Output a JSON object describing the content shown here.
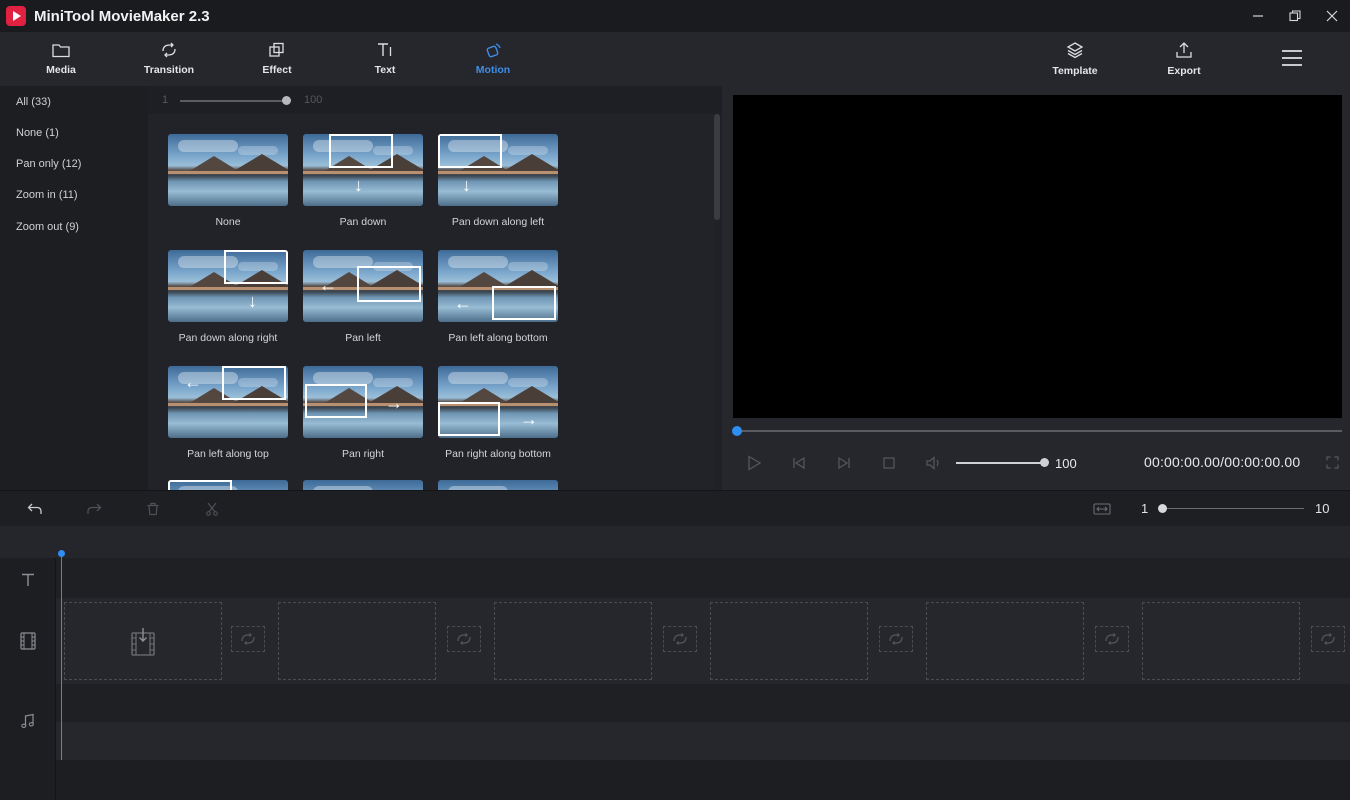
{
  "window": {
    "title": "MiniTool MovieMaker 2.3",
    "controls": [
      "minimize-icon",
      "restore-icon",
      "close-icon"
    ]
  },
  "toolbar": {
    "tabs": [
      {
        "label": "Media",
        "icon": "folder-icon",
        "active": false
      },
      {
        "label": "Transition",
        "icon": "transition-icon",
        "active": false
      },
      {
        "label": "Effect",
        "icon": "effect-icon",
        "active": false
      },
      {
        "label": "Text",
        "icon": "text-icon",
        "active": false
      },
      {
        "label": "Motion",
        "icon": "motion-icon",
        "active": true
      }
    ],
    "right": [
      {
        "label": "Template",
        "icon": "layers-icon"
      },
      {
        "label": "Export",
        "icon": "upload-icon"
      }
    ],
    "menu_icon": "hamburger-menu-icon"
  },
  "categories": [
    {
      "label": "All",
      "count": "(33)"
    },
    {
      "label": "None",
      "count": "(1)"
    },
    {
      "label": "Pan only",
      "count": "(12)"
    },
    {
      "label": "Zoom in",
      "count": "(11)"
    },
    {
      "label": "Zoom out",
      "count": "(9)"
    }
  ],
  "thumb_size": {
    "min": "1",
    "max": "100",
    "value": 100
  },
  "motions": [
    {
      "label": "None"
    },
    {
      "label": "Pan down"
    },
    {
      "label": "Pan down along left"
    },
    {
      "label": "Pan down along right"
    },
    {
      "label": "Pan left"
    },
    {
      "label": "Pan left along bottom"
    },
    {
      "label": "Pan left along top"
    },
    {
      "label": "Pan right"
    },
    {
      "label": "Pan right along bottom"
    }
  ],
  "player": {
    "progress": 0,
    "volume": "100",
    "volume_level": 100,
    "timecode": "00:00:00.00/00:00:00.00",
    "controls": [
      "play-icon",
      "previous-frame-icon",
      "next-frame-icon",
      "stop-icon",
      "volume-icon",
      "fullscreen-icon"
    ]
  },
  "timeline": {
    "tools": [
      "undo-icon",
      "redo-icon",
      "delete-icon",
      "split-icon"
    ],
    "fit_icon": "fit-to-timeline-icon",
    "zoom": {
      "min": "1",
      "max": "10",
      "value": 1
    },
    "tracks": [
      "text-track-icon",
      "video-track-icon",
      "music-track-icon"
    ]
  },
  "colors": {
    "accent": "#2f8ef2",
    "active_tab": "#3d8ee8",
    "video_bg": "#000000"
  }
}
